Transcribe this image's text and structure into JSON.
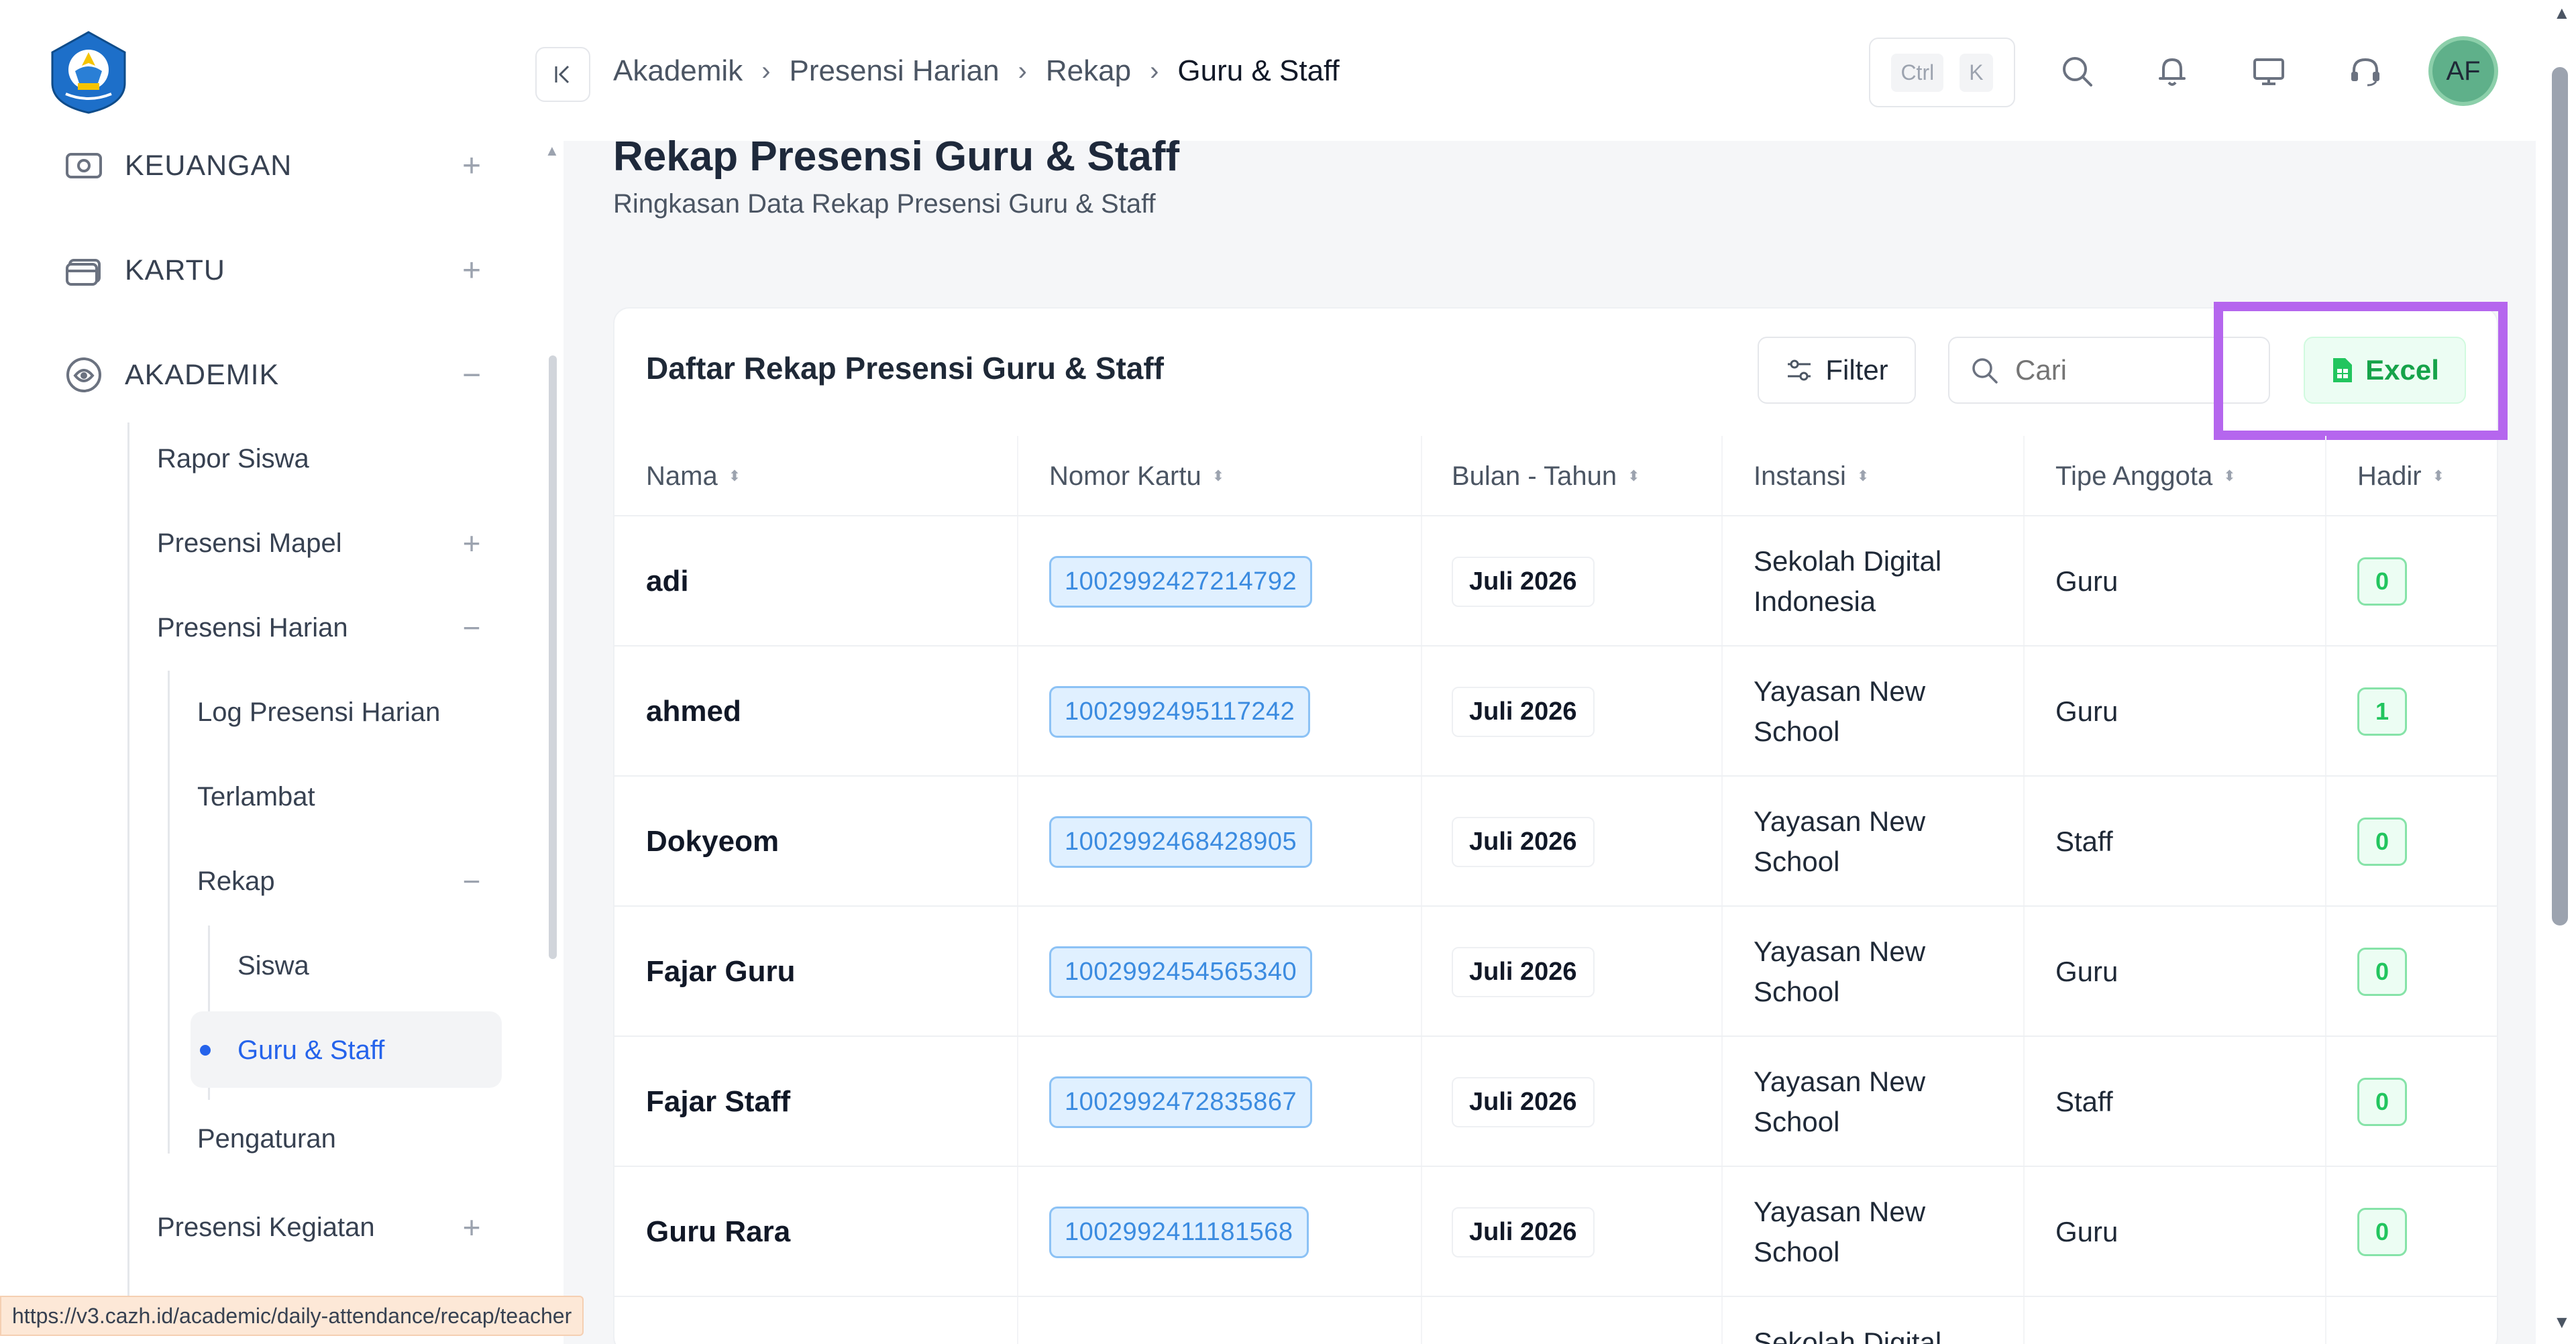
{
  "sidebar": {
    "sections": [
      {
        "label": "KEUANGAN",
        "icon": "money-icon",
        "toggle": "+"
      },
      {
        "label": "KARTU",
        "icon": "card-icon",
        "toggle": "+"
      },
      {
        "label": "AKADEMIK",
        "icon": "academic-icon",
        "toggle": "−"
      }
    ],
    "items": {
      "rapor": "Rapor Siswa",
      "presensi_mapel": "Presensi Mapel",
      "presensi_mapel_toggle": "+",
      "presensi_harian": "Presensi Harian",
      "presensi_harian_toggle": "−",
      "log": "Log Presensi Harian",
      "terlambat": "Terlambat",
      "rekap": "Rekap",
      "rekap_toggle": "−",
      "siswa": "Siswa",
      "guru_staff": "Guru & Staff",
      "pengaturan": "Pengaturan",
      "presensi_kegiatan": "Presensi Kegiatan",
      "presensi_kegiatan_toggle": "+"
    }
  },
  "header": {
    "breadcrumb": [
      "Akademik",
      "Presensi Harian",
      "Rekap",
      "Guru & Staff"
    ],
    "shortcut": {
      "key1": "Ctrl",
      "key2": "K"
    },
    "avatar_initials": "AF"
  },
  "page": {
    "title": "Rekap Presensi Guru & Staff",
    "subtitle": "Ringkasan Data Rekap Presensi Guru & Staff"
  },
  "card": {
    "title": "Daftar Rekap Presensi Guru & Staff",
    "filter_label": "Filter",
    "search_placeholder": "Cari",
    "excel_label": "Excel"
  },
  "table": {
    "columns": [
      "Nama",
      "Nomor Kartu",
      "Bulan - Tahun",
      "Instansi",
      "Tipe Anggota",
      "Hadir"
    ],
    "rows": [
      {
        "nama": "adi",
        "kartu": "1002992427214792",
        "bulan": "Juli 2026",
        "instansi1": "Sekolah Digital",
        "instansi2": "Indonesia",
        "tipe": "Guru",
        "hadir": "0"
      },
      {
        "nama": "ahmed",
        "kartu": "1002992495117242",
        "bulan": "Juli 2026",
        "instansi1": "Yayasan New",
        "instansi2": "School",
        "tipe": "Guru",
        "hadir": "1"
      },
      {
        "nama": "Dokyeom",
        "kartu": "1002992468428905",
        "bulan": "Juli 2026",
        "instansi1": "Yayasan New",
        "instansi2": "School",
        "tipe": "Staff",
        "hadir": "0"
      },
      {
        "nama": "Fajar Guru",
        "kartu": "1002992454565340",
        "bulan": "Juli 2026",
        "instansi1": "Yayasan New",
        "instansi2": "School",
        "tipe": "Guru",
        "hadir": "0"
      },
      {
        "nama": "Fajar Staff",
        "kartu": "1002992472835867",
        "bulan": "Juli 2026",
        "instansi1": "Yayasan New",
        "instansi2": "School",
        "tipe": "Staff",
        "hadir": "0"
      },
      {
        "nama": "Guru Rara",
        "kartu": "1002992411181568",
        "bulan": "Juli 2026",
        "instansi1": "Yayasan New",
        "instansi2": "School",
        "tipe": "Guru",
        "hadir": "0"
      }
    ],
    "partial_next": "Sekolah Digital"
  },
  "status_url": "https://v3.cazh.id/academic/daily-attendance/recap/teacher",
  "colors": {
    "accent": "#2563eb",
    "excel_green": "#16a34a",
    "highlight": "#b566ee"
  }
}
